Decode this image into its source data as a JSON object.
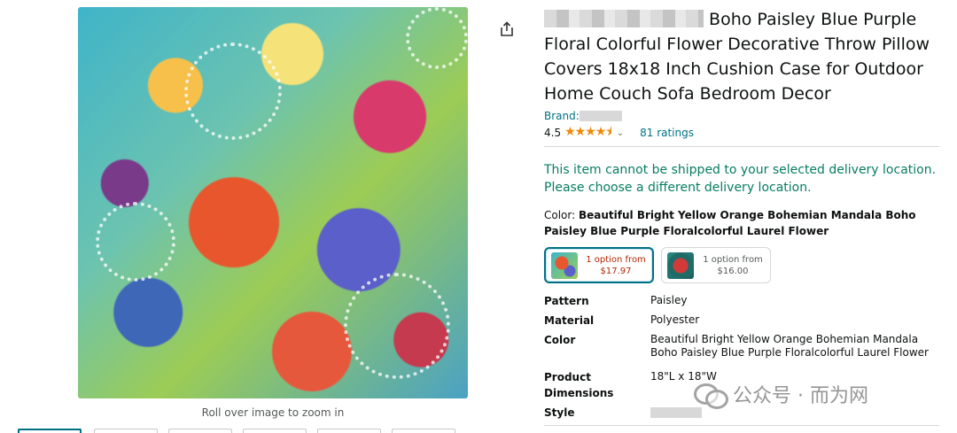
{
  "product": {
    "title_suffix": "Boho Paisley Blue Purple Floral Colorful Flower Decorative Throw Pillow Covers 18x18 Inch Cushion Case for Outdoor Home Couch Sofa Bedroom Decor",
    "brand_label": "Brand:",
    "rating_value": "4.5",
    "rating_count": "81 ratings",
    "star_glyphs": "★★★★⯨"
  },
  "shipping": {
    "message": "This item cannot be shipped to your selected delivery location. Please choose a different delivery location."
  },
  "color": {
    "label": "Color:",
    "selected_value": "Beautiful Bright Yellow Orange Bohemian Mandala Boho Paisley Blue Purple Floralcolorful Laurel Flower"
  },
  "swatches": [
    {
      "line1": "1 option from",
      "line2": "$17.97",
      "selected": true
    },
    {
      "line1": "1 option from",
      "line2": "$16.00",
      "selected": false
    }
  ],
  "specs": [
    {
      "key": "Pattern",
      "value": "Paisley"
    },
    {
      "key": "Material",
      "value": "Polyester"
    },
    {
      "key": "Color",
      "value": "Beautiful Bright Yellow Orange Bohemian Mandala Boho Paisley Blue Purple Floralcolorful Laurel Flower"
    },
    {
      "key": "Product Dimensions",
      "value": "18\"L x 18\"W"
    },
    {
      "key": "Style",
      "value": ""
    }
  ],
  "image": {
    "zoom_hint": "Roll over image to zoom in"
  },
  "watermark": {
    "text": "公众号 · 而为网"
  },
  "icons": {
    "share": "share-icon"
  },
  "colors": {
    "link": "#007185",
    "ship_green": "#067d62",
    "price_red": "#b12704",
    "star": "#f08804"
  }
}
